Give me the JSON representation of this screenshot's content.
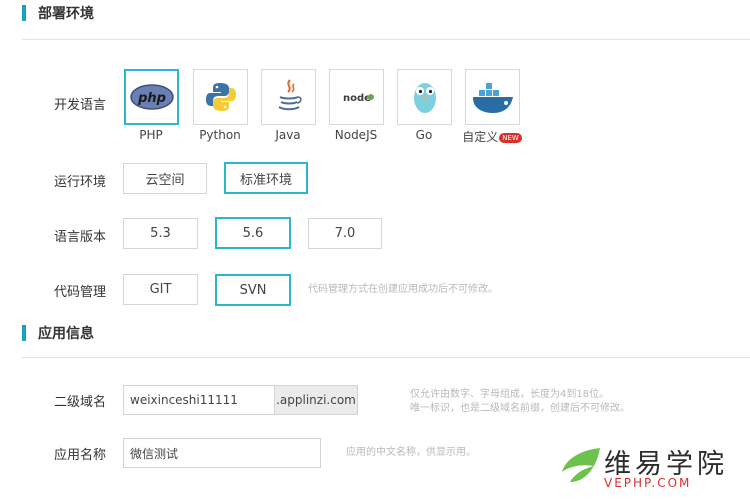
{
  "section_deploy": {
    "title": "部署环境"
  },
  "language": {
    "label": "开发语言",
    "options": [
      {
        "name": "PHP",
        "icon": "php-icon",
        "selected": true
      },
      {
        "name": "Python",
        "icon": "python-icon",
        "selected": false
      },
      {
        "name": "Java",
        "icon": "java-icon",
        "selected": false
      },
      {
        "name": "NodeJS",
        "icon": "nodejs-icon",
        "selected": false
      },
      {
        "name": "Go",
        "icon": "go-icon",
        "selected": false
      },
      {
        "name": "自定义",
        "icon": "docker-icon",
        "selected": false,
        "badge": "NEW"
      }
    ],
    "php_logo_text": "php",
    "node_logo_text": "node"
  },
  "runtime": {
    "label": "运行环境",
    "options": [
      {
        "name": "云空间",
        "selected": false
      },
      {
        "name": "标准环境",
        "selected": true
      }
    ]
  },
  "version": {
    "label": "语言版本",
    "options": [
      {
        "name": "5.3",
        "selected": false
      },
      {
        "name": "5.6",
        "selected": true
      },
      {
        "name": "7.0",
        "selected": false
      }
    ]
  },
  "vcs": {
    "label": "代码管理",
    "options": [
      {
        "name": "GIT",
        "selected": false
      },
      {
        "name": "SVN",
        "selected": true
      }
    ],
    "hint": "代码管理方式在创建应用成功后不可修改。"
  },
  "section_app": {
    "title": "应用信息"
  },
  "subdomain": {
    "label": "二级域名",
    "value": "weixinceshi11111",
    "suffix": ".applinzi.com",
    "hint_line1": "仅允许由数字、字母组成，长度为4到18位。",
    "hint_line2": "唯一标识，也是二级域名前缀，创建后不可修改。"
  },
  "app_name": {
    "label": "应用名称",
    "value": "微信测试",
    "hint": "应用的中文名称，供显示用。"
  },
  "watermark": {
    "cn": "维易学院",
    "en": "VEPHP.COM"
  },
  "colors": {
    "accent": "#2bb7c9",
    "section_bar": "#1aa2c6",
    "badge": "#d9302b"
  }
}
